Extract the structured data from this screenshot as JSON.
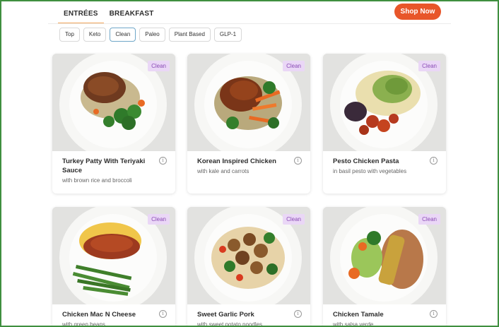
{
  "nav": {
    "tabs": [
      {
        "label": "ENTRÉES",
        "active": true
      },
      {
        "label": "BREAKFAST",
        "active": false
      }
    ],
    "shop_label": "Shop Now"
  },
  "filters": [
    {
      "label": "Top",
      "active": false
    },
    {
      "label": "Keto",
      "active": false
    },
    {
      "label": "Clean",
      "active": true
    },
    {
      "label": "Paleo",
      "active": false
    },
    {
      "label": "Plant Based",
      "active": false
    },
    {
      "label": "GLP-1",
      "active": false
    }
  ],
  "meals": [
    {
      "badge": "Clean",
      "title": "Turkey Patty With Teriyaki Sauce",
      "desc": "with brown rice and broccoli"
    },
    {
      "badge": "Clean",
      "title": "Korean Inspired Chicken",
      "desc": "with kale and carrots"
    },
    {
      "badge": "Clean",
      "title": "Pesto Chicken Pasta",
      "desc": "in basil pesto with vegetables"
    },
    {
      "badge": "Clean",
      "title": "Chicken Mac N Cheese",
      "desc": "with green beans"
    },
    {
      "badge": "Clean",
      "title": "Sweet Garlic Pork",
      "desc": "with sweet potato noodles"
    },
    {
      "badge": "Clean",
      "title": "Chicken Tamale",
      "desc": "with salsa verde"
    }
  ],
  "icons": {
    "info": "info-icon"
  },
  "colors": {
    "accent": "#e8562a",
    "badge_bg": "#ead7f6",
    "badge_text": "#8a4bb5",
    "tab_underline": "#f2a65a"
  }
}
